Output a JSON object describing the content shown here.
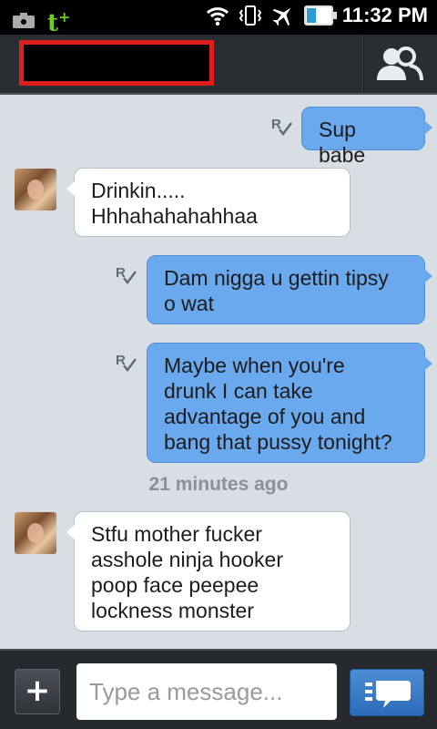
{
  "status_bar": {
    "time": "11:32 PM",
    "icons": [
      "camera-icon",
      "tumblr-icon",
      "wifi-icon",
      "vibrate-icon",
      "airplane-icon",
      "battery-icon"
    ],
    "tumblr_glyph": "t",
    "tumblr_plus": "+"
  },
  "header": {
    "contact_name": "",
    "contact_button_icon": "contact-profile-icon"
  },
  "messages": [
    {
      "direction": "out",
      "text": "Sup babe",
      "status_icon": "read-receipt-icon"
    },
    {
      "direction": "in",
      "lines": [
        "Drinkin.....",
        "Hhhahahahahhaa"
      ]
    },
    {
      "direction": "out",
      "lines": [
        "Dam nigga u gettin tipsy",
        "o wat"
      ],
      "status_icon": "read-receipt-icon"
    },
    {
      "direction": "out",
      "lines": [
        "Maybe when you're",
        "drunk I can take",
        "advantage of you and",
        "bang that pussy tonight?"
      ],
      "status_icon": "read-receipt-icon"
    },
    {
      "direction": "in",
      "lines": [
        "Stfu mother fucker",
        "asshole ninja hooker",
        "poop face peepee",
        "lockness monster"
      ]
    }
  ],
  "timestamp": "21 minutes ago",
  "compose": {
    "attach_label": "+",
    "placeholder": "Type a message...",
    "value": "",
    "send_icon": "send-message-icon"
  },
  "colors": {
    "outgoing_bubble": "#6aa9ee",
    "incoming_bubble": "#ffffff",
    "thread_background": "#d9dee4",
    "header_background": "#2a2d31",
    "tumblr_green": "#6fcc1e",
    "send_button": "#3a7cc7"
  }
}
